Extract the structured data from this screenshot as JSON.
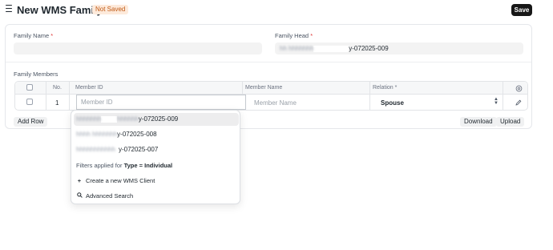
{
  "header": {
    "title": "New WMS Family",
    "status_badge": "Not Saved",
    "save_label": "Save"
  },
  "form": {
    "family_name": {
      "label": "Family Name",
      "required": "*",
      "value": ""
    },
    "family_head": {
      "label": "Family Head",
      "required": "*",
      "value_suffix": "y-072025-009"
    },
    "section_label": "Family Members"
  },
  "table": {
    "columns": {
      "no": "No.",
      "member_id": "Member ID",
      "member_name": "Member Name",
      "relation": "Relation",
      "relation_required": "*"
    },
    "row": {
      "no": "1",
      "member_id_placeholder": "Member ID",
      "member_name_placeholder": "Member Name",
      "relation": "Spouse"
    },
    "buttons": {
      "add_row": "Add Row",
      "download": "Download",
      "upload": "Upload"
    }
  },
  "dropdown": {
    "options": [
      {
        "suffix": "y-072025-009"
      },
      {
        "suffix": "y-072025-008"
      },
      {
        "suffix": "y-072025-007"
      }
    ],
    "filter_note_prefix": "Filters applied for ",
    "filter_note_bold": "Type = Individual",
    "create_label": "Create a new WMS Client",
    "advanced_search_label": "Advanced Search"
  },
  "icons": {
    "menu": "hamburger-icon",
    "settings": "settings-icon",
    "edit": "pencil-icon",
    "create": "plus-icon",
    "search": "search-icon",
    "select": "chevron-updown-icon"
  },
  "colors": {
    "badge_text": "#c05a16",
    "badge_bg": "#fdeadb",
    "primary_button": "#171717",
    "required": "#e03636"
  }
}
